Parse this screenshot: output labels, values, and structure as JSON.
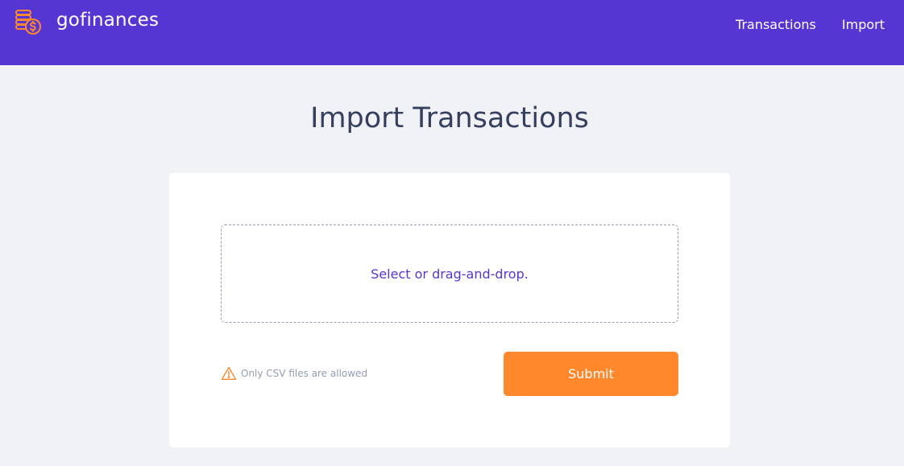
{
  "header": {
    "app_name": "gofinances",
    "logo_icon": "stacked-coins-dollar-icon",
    "background_color": "#5636d3",
    "icon_color": "#ff872c",
    "nav": [
      {
        "label": "Transactions"
      },
      {
        "label": "Import"
      }
    ]
  },
  "main": {
    "title": "Import Transactions",
    "dropzone": {
      "label": "Select or drag-and-drop."
    },
    "hint": {
      "icon": "alert-triangle-icon",
      "text": "Only CSV files are allowed"
    },
    "submit_label": "Submit",
    "accent_color": "#ff872c",
    "primary_color": "#5636d3",
    "text_color": "#363f5f",
    "muted_color": "#969cb3"
  }
}
